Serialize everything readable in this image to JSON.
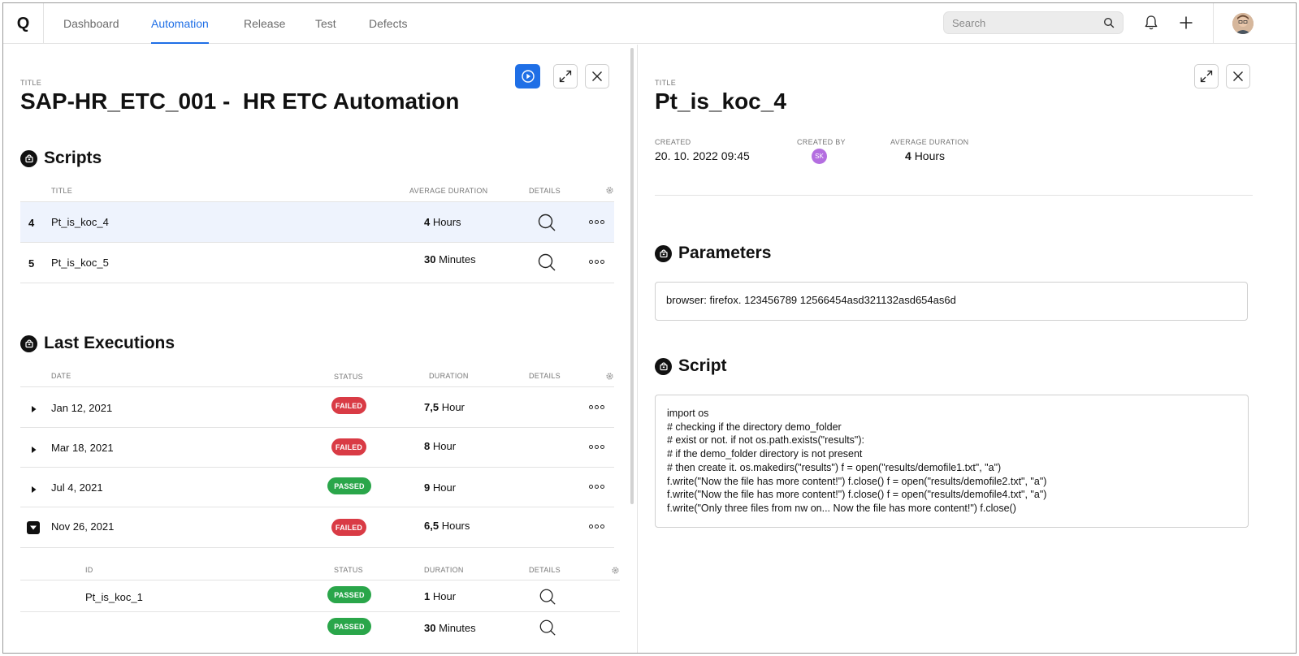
{
  "nav": {
    "logo": "Q",
    "tabs": [
      {
        "label": "Dashboard",
        "active": false
      },
      {
        "label": "Automation",
        "active": true
      },
      {
        "label": "Release",
        "active": false
      },
      {
        "label": "Test",
        "active": false
      },
      {
        "label": "Defects",
        "active": false
      }
    ],
    "search_placeholder": "Search",
    "icons": [
      "search-icon",
      "bell-icon",
      "plus-icon",
      "user-avatar"
    ],
    "accent": "#1f6fe6"
  },
  "left": {
    "title_caption": "TITLE",
    "title": "SAP-HR_ETC_001 -  HR ETC Automation",
    "scripts": {
      "heading": "Scripts",
      "columns": {
        "title": "TITLE",
        "avg_duration": "AVERAGE DURATION",
        "details": "DETAILS"
      },
      "rows": [
        {
          "num": "4",
          "title": "Pt_is_koc_4",
          "duration_value": "4",
          "duration_unit": "Hours",
          "selected": true
        },
        {
          "num": "5",
          "title": "Pt_is_koc_5",
          "duration_value": "30",
          "duration_unit": "Minutes",
          "selected": false
        }
      ]
    },
    "executions": {
      "heading": "Last Executions",
      "columns": {
        "date": "DATE",
        "status": "STATUS",
        "duration": "DURATION",
        "details": "DETAILS"
      },
      "rows": [
        {
          "date": "Jan 12, 2021",
          "status": "FAILED",
          "duration_value": "7,5",
          "duration_unit": "Hour",
          "expanded": false
        },
        {
          "date": "Mar 18, 2021",
          "status": "FAILED",
          "duration_value": "8",
          "duration_unit": "Hour",
          "expanded": false
        },
        {
          "date": "Jul 4, 2021",
          "status": "PASSED",
          "duration_value": "9",
          "duration_unit": "Hour",
          "expanded": false
        },
        {
          "date": "Nov 26, 2021",
          "status": "FAILED",
          "duration_value": "6,5",
          "duration_unit": "Hours",
          "expanded": true
        }
      ],
      "sub": {
        "columns": {
          "id": "ID",
          "status": "STATUS",
          "duration": "DURATION",
          "details": "DETAILS"
        },
        "rows": [
          {
            "id": "Pt_is_koc_1",
            "status": "PASSED",
            "duration_value": "1",
            "duration_unit": "Hour"
          },
          {
            "id": "",
            "status": "PASSED",
            "duration_value": "30",
            "duration_unit": "Minutes"
          }
        ]
      }
    }
  },
  "right": {
    "title_caption": "TITLE",
    "title": "Pt_is_koc_4",
    "meta": {
      "created_label": "CREATED",
      "created_value": "20. 10. 2022 09:45",
      "created_by_label": "CREATED BY",
      "created_by_initials": "SK",
      "avg_label": "AVERAGE DURATION",
      "avg_value": "4",
      "avg_unit": "Hours"
    },
    "parameters": {
      "heading": "Parameters",
      "value": "browser: firefox. 123456789 12566454asd321132asd654as6d"
    },
    "script": {
      "heading": "Script",
      "lines": [
        "import os",
        "# checking if the directory demo_folder",
        "# exist or not. if not os.path.exists(\"results\"):",
        "# if the demo_folder directory is not present",
        "# then create it. os.makedirs(\"results\") f = open(\"results/demofile1.txt\", \"a\")",
        "f.write(\"Now the file has more content!\") f.close() f = open(\"results/demofile2.txt\", \"a\")",
        "f.write(\"Now the file has more content!\") f.close() f = open(\"results/demofile4.txt\", \"a\")",
        "f.write(\"Only three files from nw on... Now the file has more content!\") f.close()"
      ]
    }
  },
  "colors": {
    "failed": "#d93b45",
    "passed": "#2aa64a",
    "selected_row": "#eef3fd"
  }
}
